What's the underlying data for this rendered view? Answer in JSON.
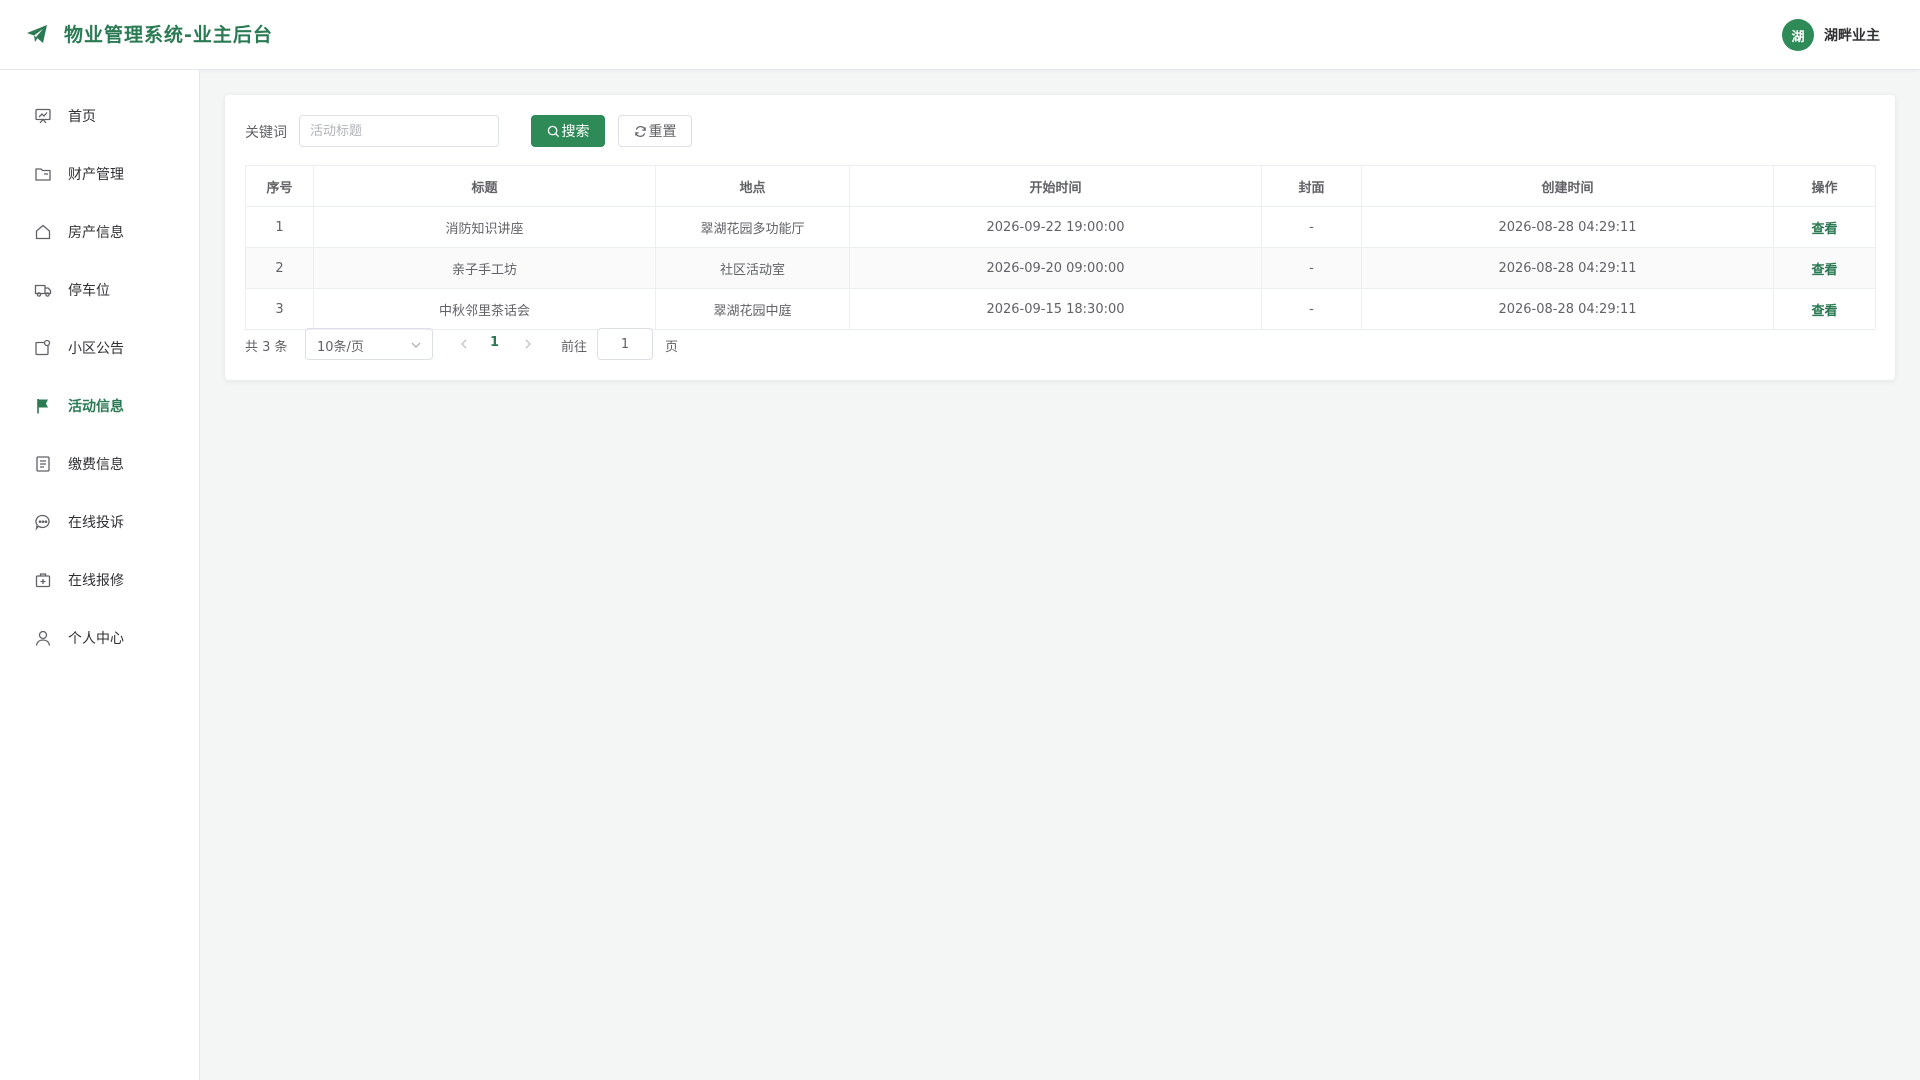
{
  "header": {
    "title": "物业管理系统-业主后台",
    "logo_icon": "paper-plane-icon",
    "user": {
      "avatar_text": "湖",
      "name": "湖畔业主"
    }
  },
  "colors": {
    "accent": "#2e8b57",
    "accent_text": "#2a7a53"
  },
  "sidebar": {
    "items": [
      {
        "label": "首页",
        "icon": "dashboard-icon",
        "active": false
      },
      {
        "label": "财产管理",
        "icon": "folder-icon",
        "active": false
      },
      {
        "label": "房产信息",
        "icon": "house-icon",
        "active": false
      },
      {
        "label": "停车位",
        "icon": "truck-icon",
        "active": false
      },
      {
        "label": "小区公告",
        "icon": "notice-icon",
        "active": false
      },
      {
        "label": "活动信息",
        "icon": "flag-icon",
        "active": true
      },
      {
        "label": "缴费信息",
        "icon": "document-icon",
        "active": false
      },
      {
        "label": "在线投诉",
        "icon": "chat-icon",
        "active": false
      },
      {
        "label": "在线报修",
        "icon": "repair-kit-icon",
        "active": false
      },
      {
        "label": "个人中心",
        "icon": "user-icon",
        "active": false
      }
    ]
  },
  "search": {
    "label": "关键词",
    "placeholder": "活动标题",
    "value": "",
    "search_button": "搜索",
    "reset_button": "重置"
  },
  "table": {
    "columns": [
      "序号",
      "标题",
      "地点",
      "开始时间",
      "封面",
      "创建时间",
      "操作"
    ],
    "rows": [
      {
        "index": "1",
        "title": "消防知识讲座",
        "location": "翠湖花园多功能厅",
        "start": "2026-09-22 19:00:00",
        "cover": "-",
        "created": "2026-08-28 04:29:11",
        "action": "查看"
      },
      {
        "index": "2",
        "title": "亲子手工坊",
        "location": "社区活动室",
        "start": "2026-09-20 09:00:00",
        "cover": "-",
        "created": "2026-08-28 04:29:11",
        "action": "查看"
      },
      {
        "index": "3",
        "title": "中秋邻里茶话会",
        "location": "翠湖花园中庭",
        "start": "2026-09-15 18:30:00",
        "cover": "-",
        "created": "2026-08-28 04:29:11",
        "action": "查看"
      }
    ]
  },
  "pagination": {
    "total_text": "共 3 条",
    "page_size": "10条/页",
    "current_page": "1",
    "goto_label": "前往",
    "goto_value": "1",
    "page_unit": "页"
  }
}
